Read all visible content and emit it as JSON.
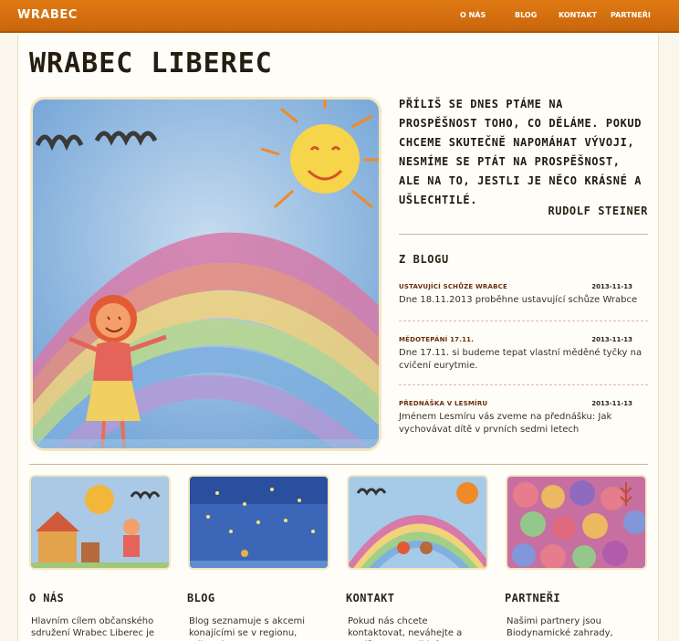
{
  "header": {
    "brand": "WRABEC",
    "nav": [
      "O NÁS",
      "BLOG",
      "KONTAKT",
      "PARTNEŘI"
    ]
  },
  "page": {
    "title": "WRABEC LIBEREC",
    "hero_alt": "children drawing of a rainbow with a girl and sun"
  },
  "quote": {
    "text": "PŘÍLIŠ SE DNES PTÁME NA PROSPĚŠNOST TOHO, CO DĚLÁME. POKUD CHCEME SKUTEČNĚ NAPOMÁHAT VÝVOJI, NESMÍME SE PTÁT NA PROSPĚŠNOST, ALE NA TO, JESTLI JE NĚCO KRÁSNÉ A UŠLECHTILÉ.",
    "author": "RUDOLF STEINER"
  },
  "blog": {
    "heading": "Z BLOGU",
    "posts": [
      {
        "title": "USTAVUJÍCÍ SCHŮZE WRABCE",
        "date": "2013-11-13",
        "text": "Dne 18.11.2013 proběhne ustavující schůze Wrabce"
      },
      {
        "title": "MĚDOTEPÁNÍ 17.11.",
        "date": "2013-11-13",
        "text": "Dne 17.11. si budeme tepat vlastní měděné tyčky na cvičení eurytmie."
      },
      {
        "title": "PŘEDNÁŠKA V LESMÍRU",
        "date": "2013-11-13",
        "text": "Jménem Lesmíru vás zveme na přednášku: Jak vychovávat dítě v prvních sedmi letech"
      }
    ]
  },
  "columns": [
    {
      "heading": "O NÁS",
      "text": "Hlavním cílem občanského sdružení Wrabec Liberec je"
    },
    {
      "heading": "BLOG",
      "text": "Blog seznamuje s akcemi konajícími se v regionu, odkazuje"
    },
    {
      "heading": "KONTAKT",
      "text": "Pokud nás chcete kontaktovat, neváhejte a napište na email info"
    },
    {
      "heading": "PARTNEŘI",
      "text": "Našimi partnery jsou Biodynamické zahrady,"
    }
  ]
}
